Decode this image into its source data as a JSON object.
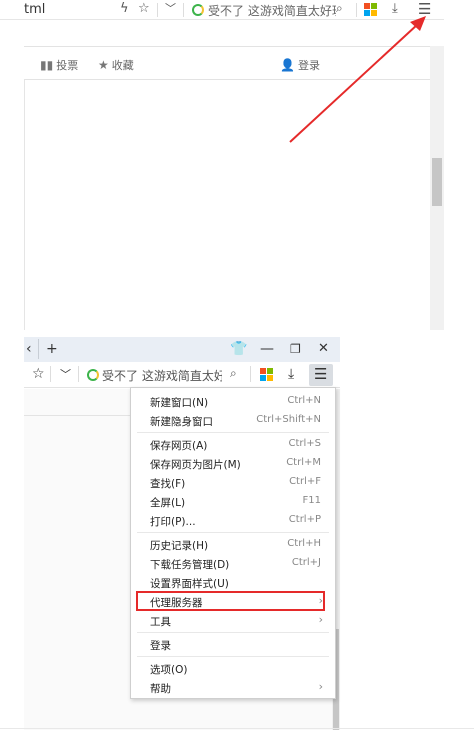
{
  "top": {
    "url_fragment": "tml",
    "address_text": "受不了 这游戏简直太好玩",
    "subbar": {
      "vote_label": "投票",
      "favorite_label": "收藏",
      "login_label": "登录"
    },
    "icons": [
      "lightning-icon",
      "star-icon",
      "chevron-down-icon",
      "search-icon",
      "apps-grid-icon",
      "download-icon",
      "menu-icon"
    ]
  },
  "bottom": {
    "titlebar": {
      "back_glyph": "‹",
      "new_tab_glyph": "+",
      "minimize_glyph": "—",
      "restore_glyph": "❐",
      "close_glyph": "✕"
    },
    "address_text": "受不了 这游戏简直太好玩",
    "menu": {
      "items": [
        {
          "label": "新建窗口(N)",
          "shortcut": "Ctrl+N"
        },
        {
          "label": "新建隐身窗口",
          "shortcut": "Ctrl+Shift+N"
        },
        {
          "label": "保存网页(A)",
          "shortcut": "Ctrl+S"
        },
        {
          "label": "保存网页为图片(M)",
          "shortcut": "Ctrl+M"
        },
        {
          "label": "查找(F)",
          "shortcut": "Ctrl+F"
        },
        {
          "label": "全屏(L)",
          "shortcut": "F11"
        },
        {
          "label": "打印(P)...",
          "shortcut": "Ctrl+P"
        },
        {
          "label": "历史记录(H)",
          "shortcut": "Ctrl+H"
        },
        {
          "label": "下载任务管理(D)",
          "shortcut": "Ctrl+J"
        },
        {
          "label": "设置界面样式(U)",
          "shortcut": ""
        },
        {
          "label": "代理服务器",
          "shortcut": "›"
        },
        {
          "label": "工具",
          "shortcut": "›"
        },
        {
          "label": "登录",
          "shortcut": ""
        },
        {
          "label": "选项(O)",
          "shortcut": ""
        },
        {
          "label": "帮助",
          "shortcut": "›"
        }
      ]
    }
  },
  "colors": {
    "annotation_red": "#e52a2a",
    "grid_red": "#f25022",
    "grid_green": "#7fba00",
    "grid_blue": "#00a4ef",
    "grid_yellow": "#ffb900",
    "titlebar_bg": "#e9eef5"
  }
}
